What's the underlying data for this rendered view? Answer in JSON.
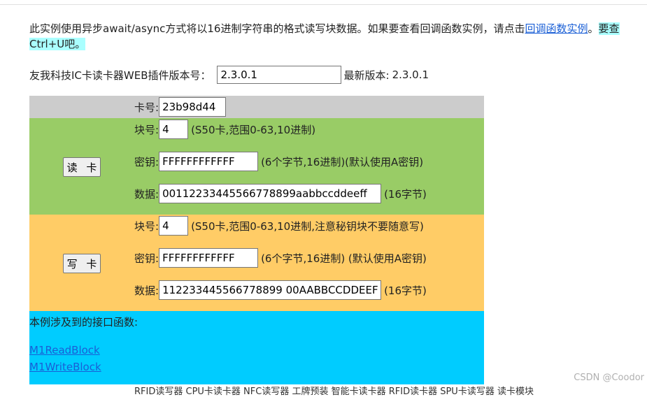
{
  "intro": {
    "text_before_link": "此实例使用异步await/async方式将以16进制字符串的格式读写块数据。如果要查看回调函数实例，请点击",
    "link_text": "回调函数实例",
    "text_after_link": "。",
    "highlight_start": "要查",
    "highlight_end": "Ctrl+U吧。"
  },
  "version": {
    "label": "友我科技IC卡读卡器WEB插件版本号：",
    "value": "2.3.0.1",
    "latest_label": "最新版本:",
    "latest_value": "2.3.0.1"
  },
  "card": {
    "label": "卡号:",
    "value": "23b98d44"
  },
  "read": {
    "button": "读 卡",
    "block_label": "块号:",
    "block_value": "4",
    "block_note": "(S50卡,范围0-63,10进制)",
    "key_label": "密钥:",
    "key_value": "FFFFFFFFFFFF",
    "key_note": "(6个字节,16进制)(默认使用A密钥)",
    "data_label": "数据:",
    "data_value": "00112233445566778899aabbccddeeff",
    "data_note": "(16字节)"
  },
  "write": {
    "button": "写 卡",
    "block_label": "块号:",
    "block_value": "4",
    "block_note": "(S50卡,范围0-63,10进制,注意秘钥块不要随意写)",
    "key_label": "密钥:",
    "key_value": "FFFFFFFFFFFF",
    "key_note": "(6个字节,16进制) (默认使用A密钥)",
    "data_label": "数据:",
    "data_value": "112233445566778899 00AABBCCDDEEFF",
    "data_note": "(16字节)"
  },
  "api": {
    "title": "本例涉及到的接口函数:",
    "links": [
      "M1ReadBlock",
      "M1WriteBlock"
    ]
  },
  "footer_cut": "RFID读写器 CPU卡读卡器 NFC读写器 工牌预装 智能卡读卡器 RFID读卡器 SPU卡读写器 读卡模块",
  "watermark": "CSDN @Coodor",
  "colors": {
    "card_row": "#cccccc",
    "read_bg": "#99cc66",
    "write_bg": "#ffcc66",
    "api_bg": "#00ccff",
    "highlight": "#aaffff",
    "link": "#1a5fd6"
  }
}
